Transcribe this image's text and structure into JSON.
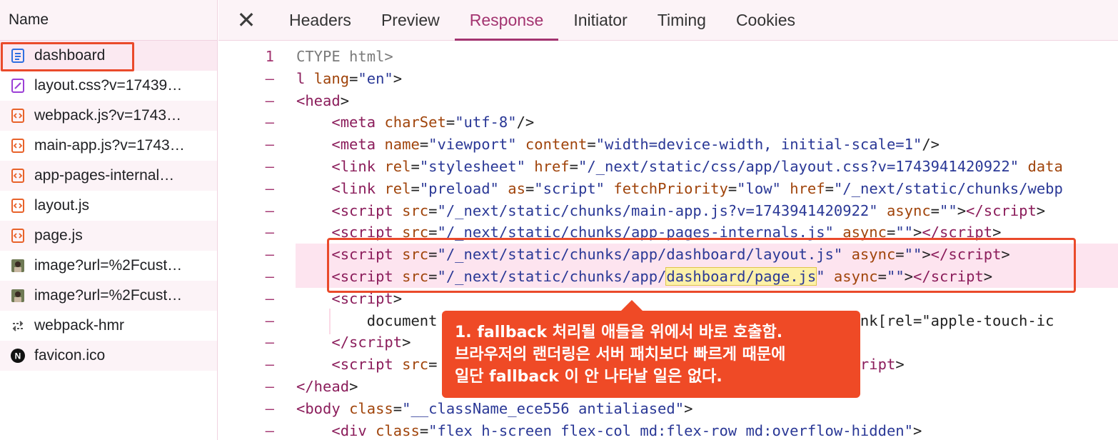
{
  "sidebar": {
    "header": "Name",
    "files": [
      {
        "name": "dashboard",
        "icon": "document-icon"
      },
      {
        "name": "layout.css?v=17439…",
        "icon": "stylesheet-icon"
      },
      {
        "name": "webpack.js?v=1743…",
        "icon": "script-icon"
      },
      {
        "name": "main-app.js?v=1743…",
        "icon": "script-icon"
      },
      {
        "name": "app-pages-internal…",
        "icon": "script-icon"
      },
      {
        "name": "layout.js",
        "icon": "script-icon"
      },
      {
        "name": "page.js",
        "icon": "script-icon"
      },
      {
        "name": "image?url=%2Fcust…",
        "icon": "image-thumbnail-icon"
      },
      {
        "name": "image?url=%2Fcust…",
        "icon": "image-thumbnail-icon"
      },
      {
        "name": "webpack-hmr",
        "icon": "websocket-icon"
      },
      {
        "name": "favicon.ico",
        "icon": "nextjs-logo-icon"
      }
    ]
  },
  "tabs": {
    "close": "✕",
    "items": [
      "Headers",
      "Preview",
      "Response",
      "Initiator",
      "Timing",
      "Cookies"
    ],
    "active": "Response"
  },
  "code": {
    "gutter": [
      "1",
      "–",
      "–",
      "–",
      "–",
      "–",
      "–",
      "–",
      "–",
      "–",
      "–",
      "–",
      "–",
      "–",
      "–",
      "–",
      "–",
      "–"
    ],
    "lines": [
      [
        {
          "c": "c",
          "t": "CTYPE html>"
        }
      ],
      [
        {
          "c": "t",
          "t": "l "
        },
        {
          "c": "a",
          "t": "lang"
        },
        {
          "c": "p",
          "t": "="
        },
        {
          "c": "s",
          "t": "\"en\""
        },
        {
          "c": "p",
          "t": ">"
        }
      ],
      [
        {
          "c": "t",
          "t": "<head"
        },
        {
          "c": "p",
          "t": ">"
        }
      ],
      [
        {
          "c": "p",
          "t": "    "
        },
        {
          "c": "t",
          "t": "<meta "
        },
        {
          "c": "a",
          "t": "charSet"
        },
        {
          "c": "p",
          "t": "="
        },
        {
          "c": "s",
          "t": "\"utf-8\""
        },
        {
          "c": "p",
          "t": "/>"
        }
      ],
      [
        {
          "c": "p",
          "t": "    "
        },
        {
          "c": "t",
          "t": "<meta "
        },
        {
          "c": "a",
          "t": "name"
        },
        {
          "c": "p",
          "t": "="
        },
        {
          "c": "s",
          "t": "\"viewport\""
        },
        {
          "c": "p",
          "t": " "
        },
        {
          "c": "a",
          "t": "content"
        },
        {
          "c": "p",
          "t": "="
        },
        {
          "c": "s",
          "t": "\"width=device-width, initial-scale=1\""
        },
        {
          "c": "p",
          "t": "/>"
        }
      ],
      [
        {
          "c": "p",
          "t": "    "
        },
        {
          "c": "t",
          "t": "<link "
        },
        {
          "c": "a",
          "t": "rel"
        },
        {
          "c": "p",
          "t": "="
        },
        {
          "c": "s",
          "t": "\"stylesheet\""
        },
        {
          "c": "p",
          "t": " "
        },
        {
          "c": "a",
          "t": "href"
        },
        {
          "c": "p",
          "t": "="
        },
        {
          "c": "s",
          "t": "\"/_next/static/css/app/layout.css?v=1743941420922\""
        },
        {
          "c": "p",
          "t": " "
        },
        {
          "c": "a",
          "t": "data"
        }
      ],
      [
        {
          "c": "p",
          "t": "    "
        },
        {
          "c": "t",
          "t": "<link "
        },
        {
          "c": "a",
          "t": "rel"
        },
        {
          "c": "p",
          "t": "="
        },
        {
          "c": "s",
          "t": "\"preload\""
        },
        {
          "c": "p",
          "t": " "
        },
        {
          "c": "a",
          "t": "as"
        },
        {
          "c": "p",
          "t": "="
        },
        {
          "c": "s",
          "t": "\"script\""
        },
        {
          "c": "p",
          "t": " "
        },
        {
          "c": "a",
          "t": "fetchPriority"
        },
        {
          "c": "p",
          "t": "="
        },
        {
          "c": "s",
          "t": "\"low\""
        },
        {
          "c": "p",
          "t": " "
        },
        {
          "c": "a",
          "t": "href"
        },
        {
          "c": "p",
          "t": "="
        },
        {
          "c": "s",
          "t": "\"/_next/static/chunks/webp"
        }
      ],
      [
        {
          "c": "p",
          "t": "    "
        },
        {
          "c": "t",
          "t": "<script "
        },
        {
          "c": "a",
          "t": "src"
        },
        {
          "c": "p",
          "t": "="
        },
        {
          "c": "s",
          "t": "\"/_next/static/chunks/main-app.js?v=1743941420922\""
        },
        {
          "c": "p",
          "t": " "
        },
        {
          "c": "a",
          "t": "async"
        },
        {
          "c": "p",
          "t": "="
        },
        {
          "c": "s",
          "t": "\"\""
        },
        {
          "c": "p",
          "t": ">"
        },
        {
          "c": "t",
          "t": "</script"
        },
        {
          "c": "p",
          "t": ">"
        }
      ],
      [
        {
          "c": "p",
          "t": "    "
        },
        {
          "c": "t",
          "t": "<script "
        },
        {
          "c": "a",
          "t": "src"
        },
        {
          "c": "p",
          "t": "="
        },
        {
          "c": "s",
          "t": "\"/_next/static/chunks/app-pages-internals.js\""
        },
        {
          "c": "p",
          "t": " "
        },
        {
          "c": "a",
          "t": "async"
        },
        {
          "c": "p",
          "t": "="
        },
        {
          "c": "s",
          "t": "\"\""
        },
        {
          "c": "p",
          "t": ">"
        },
        {
          "c": "t",
          "t": "</script"
        },
        {
          "c": "p",
          "t": ">"
        }
      ],
      [
        {
          "c": "p",
          "t": "    "
        },
        {
          "c": "t",
          "t": "<script "
        },
        {
          "c": "a",
          "t": "src"
        },
        {
          "c": "p",
          "t": "="
        },
        {
          "c": "s",
          "t": "\"/_next/static/chunks/app/dashboard/layout.js\""
        },
        {
          "c": "p",
          "t": " "
        },
        {
          "c": "a",
          "t": "async"
        },
        {
          "c": "p",
          "t": "="
        },
        {
          "c": "s",
          "t": "\"\""
        },
        {
          "c": "p",
          "t": ">"
        },
        {
          "c": "t",
          "t": "</script"
        },
        {
          "c": "p",
          "t": ">"
        }
      ],
      [
        {
          "c": "p",
          "t": "    "
        },
        {
          "c": "t",
          "t": "<script "
        },
        {
          "c": "a",
          "t": "src"
        },
        {
          "c": "p",
          "t": "="
        },
        {
          "c": "s",
          "t": "\"/_next/static/chunks/app/"
        },
        {
          "c": "s mark",
          "t": "dashboard/page.js"
        },
        {
          "c": "s",
          "t": "\""
        },
        {
          "c": "p",
          "t": " "
        },
        {
          "c": "a",
          "t": "async"
        },
        {
          "c": "p",
          "t": "="
        },
        {
          "c": "s",
          "t": "\"\""
        },
        {
          "c": "p",
          "t": ">"
        },
        {
          "c": "t",
          "t": "</script"
        },
        {
          "c": "p",
          "t": ">"
        }
      ],
      [
        {
          "c": "p",
          "t": "    "
        },
        {
          "c": "t",
          "t": "<script"
        },
        {
          "c": "p",
          "t": ">"
        }
      ],
      [
        {
          "c": "p",
          "t": "        document                                          ody link[rel=\"apple-touch-ic"
        }
      ],
      [
        {
          "c": "p",
          "t": "    "
        },
        {
          "c": "t",
          "t": "</script"
        },
        {
          "c": "p",
          "t": ">"
        }
      ],
      [
        {
          "c": "p",
          "t": "    "
        },
        {
          "c": "t",
          "t": "<script "
        },
        {
          "c": "a",
          "t": "src"
        },
        {
          "c": "p",
          "t": "=                                        "
        },
        {
          "c": "s",
          "t": "e\"\""
        },
        {
          "c": "p",
          "t": ">"
        },
        {
          "c": "t",
          "t": "</script"
        },
        {
          "c": "p",
          "t": ">"
        }
      ],
      [
        {
          "c": "t",
          "t": "</head"
        },
        {
          "c": "p",
          "t": ">"
        }
      ],
      [
        {
          "c": "t",
          "t": "<body "
        },
        {
          "c": "a",
          "t": "class"
        },
        {
          "c": "p",
          "t": "="
        },
        {
          "c": "s",
          "t": "\"__className_ece556 antialiased\""
        },
        {
          "c": "p",
          "t": ">"
        }
      ],
      [
        {
          "c": "p",
          "t": "    "
        },
        {
          "c": "t",
          "t": "<div "
        },
        {
          "c": "a",
          "t": "class"
        },
        {
          "c": "p",
          "t": "="
        },
        {
          "c": "s",
          "t": "\"flex h-screen flex-col md:flex-row md:overflow-hidden\""
        },
        {
          "c": "p",
          "t": ">"
        }
      ]
    ],
    "highlighted_lines": [
      9,
      10
    ]
  },
  "callout": {
    "lines": [
      "1. fallback 처리될 애들을 위에서 바로 호출함.",
      "브라우저의 랜더링은 서버 패치보다 빠르게 때문에",
      "일단 fallback 이 안 나타날 일은 없다."
    ]
  },
  "colors": {
    "accent": "#a33470",
    "annotation": "#ea4a2b",
    "highlight_row": "#fde4ef",
    "tag": "#8b1d5b",
    "attribute": "#a0440b",
    "string": "#2a3896"
  }
}
